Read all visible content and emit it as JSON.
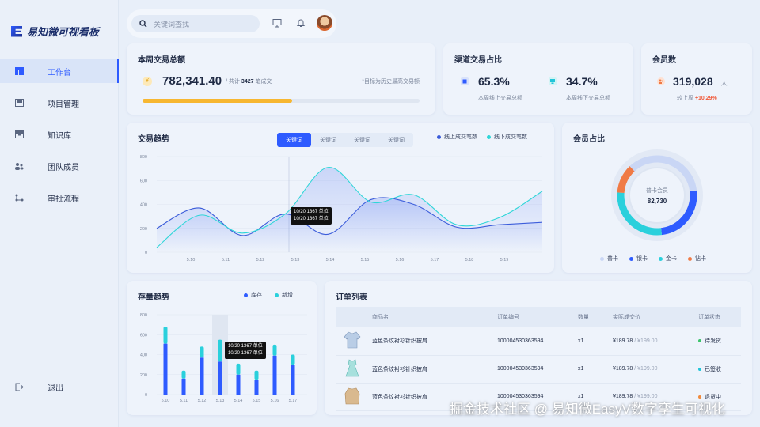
{
  "app": {
    "title": "易知微可视看板"
  },
  "sidebar": {
    "items": [
      {
        "label": "工作台",
        "icon": "dashboard-icon",
        "active": true
      },
      {
        "label": "项目管理",
        "icon": "project-icon"
      },
      {
        "label": "知识库",
        "icon": "knowledge-icon"
      },
      {
        "label": "团队成员",
        "icon": "team-icon"
      },
      {
        "label": "审批流程",
        "icon": "workflow-icon"
      }
    ],
    "logout": "退出"
  },
  "topbar": {
    "search_placeholder": "关键词查找"
  },
  "weekly": {
    "title": "本周交易总额",
    "amount": "782,341.40",
    "total_prefix": "/ 共计",
    "count": "3427",
    "total_suffix": "笔成交",
    "note": "*目标为历史最高交易额",
    "progress": 0.54
  },
  "channel": {
    "title": "渠道交易占比",
    "online_pct": "65.3%",
    "online_label": "本周线上交易总额",
    "offline_pct": "34.7%",
    "offline_label": "本周线下交易总额"
  },
  "members": {
    "title": "会员数",
    "count": "319,028",
    "unit": "人",
    "compare_label": "较上周",
    "change": "+10.29%"
  },
  "trend": {
    "title": "交易趋势",
    "tabs": [
      "关键词",
      "关键词",
      "关键词",
      "关键词"
    ],
    "legend": [
      "线上成交笔数",
      "线下成交笔数"
    ],
    "tooltip_line1": "10/20  1367 单位",
    "tooltip_line2": "10/20  1367 单位"
  },
  "member_ratio": {
    "title": "会员占比",
    "center_label": "普卡会员",
    "center_value": "82,730",
    "legend": [
      "普卡",
      "银卡",
      "金卡",
      "钻卡"
    ]
  },
  "stock": {
    "title": "存量趋势",
    "legend": [
      "库存",
      "新增"
    ],
    "tooltip_line1": "10/20  1367 单位",
    "tooltip_line2": "10/20  1367 单位"
  },
  "orders": {
    "title": "订单列表",
    "headers": [
      "商品名",
      "订单编号",
      "数量",
      "实际成交价",
      "订单状态"
    ],
    "rows": [
      {
        "name": "蓝色条纹衬衫针织披肩",
        "id": "100004530363594",
        "qty": "x1",
        "price": "¥189.78",
        "orig": "/ ¥199.00",
        "status": "待发货",
        "status_color": "#3cc46b"
      },
      {
        "name": "蓝色条纹衬衫针织披肩",
        "id": "100004530363594",
        "qty": "x1",
        "price": "¥189.78",
        "orig": "/ ¥199.00",
        "status": "已签收",
        "status_color": "#22c5d9"
      },
      {
        "name": "蓝色条纹衬衫针织披肩",
        "id": "100004530363594",
        "qty": "x1",
        "price": "¥189.78",
        "orig": "/ ¥199.00",
        "status": "退货中",
        "status_color": "#f08a3c"
      }
    ]
  },
  "watermark": "掘金技术社区 @ 易知微EasyV数字孪生可视化",
  "chart_data": [
    {
      "type": "line",
      "title": "交易趋势",
      "x": [
        "5.10",
        "5.11",
        "5.12",
        "5.13",
        "5.14",
        "5.15",
        "5.16",
        "5.17",
        "5.18",
        "5.19"
      ],
      "ylim": [
        0,
        800
      ],
      "yticks": [
        0,
        200,
        400,
        600,
        800
      ],
      "series": [
        {
          "name": "线上成交笔数",
          "color": "#3a5bd9",
          "values": [
            200,
            370,
            140,
            320,
            150,
            440,
            400,
            210,
            230,
            250
          ]
        },
        {
          "name": "线下成交笔数",
          "color": "#2fd6d8",
          "values": [
            40,
            310,
            160,
            320,
            710,
            420,
            480,
            230,
            290,
            510
          ]
        }
      ]
    },
    {
      "type": "donut",
      "title": "会员占比",
      "series": [
        {
          "name": "普卡",
          "value": 35,
          "color": "#c9d6f5"
        },
        {
          "name": "银卡",
          "value": 25,
          "color": "#2e5bff"
        },
        {
          "name": "金卡",
          "value": 28,
          "color": "#2ad0dc"
        },
        {
          "name": "钻卡",
          "value": 12,
          "color": "#f07a45"
        }
      ]
    },
    {
      "type": "bar",
      "title": "存量趋势",
      "categories": [
        "5.10",
        "5.11",
        "5.12",
        "5.13",
        "5.14",
        "5.15",
        "5.16",
        "5.17"
      ],
      "ylim": [
        0,
        800
      ],
      "yticks": [
        0,
        200,
        400,
        600,
        800
      ],
      "series": [
        {
          "name": "库存",
          "color": "#2e5bff",
          "values": [
            510,
            160,
            370,
            330,
            200,
            150,
            390,
            300
          ]
        },
        {
          "name": "新增",
          "color": "#2ad0dc",
          "values": [
            170,
            80,
            110,
            220,
            110,
            90,
            110,
            100
          ]
        }
      ]
    }
  ]
}
